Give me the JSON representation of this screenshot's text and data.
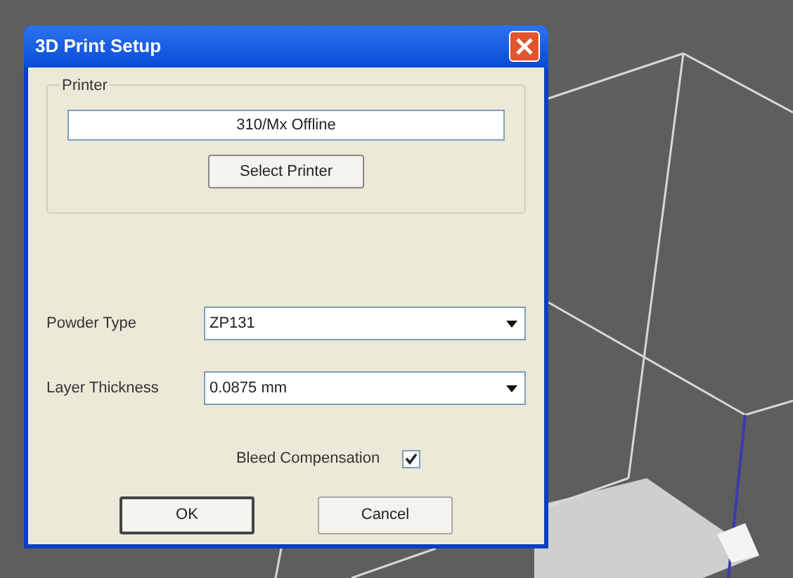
{
  "window": {
    "title": "3D Print Setup"
  },
  "printer_group": {
    "label": "Printer",
    "printer": "310/Mx Offline",
    "button": "Select Printer"
  },
  "fields": [
    {
      "label": "Powder Type",
      "value": "ZP131"
    },
    {
      "label": "Layer Thickness",
      "value": "0.0875 mm"
    }
  ],
  "bleed_compensation": {
    "label": "Bleed Compensation",
    "checked": true
  },
  "buttons": [
    {
      "label": "OK",
      "default": true
    },
    {
      "label": "Cancel",
      "default": false
    }
  ]
}
